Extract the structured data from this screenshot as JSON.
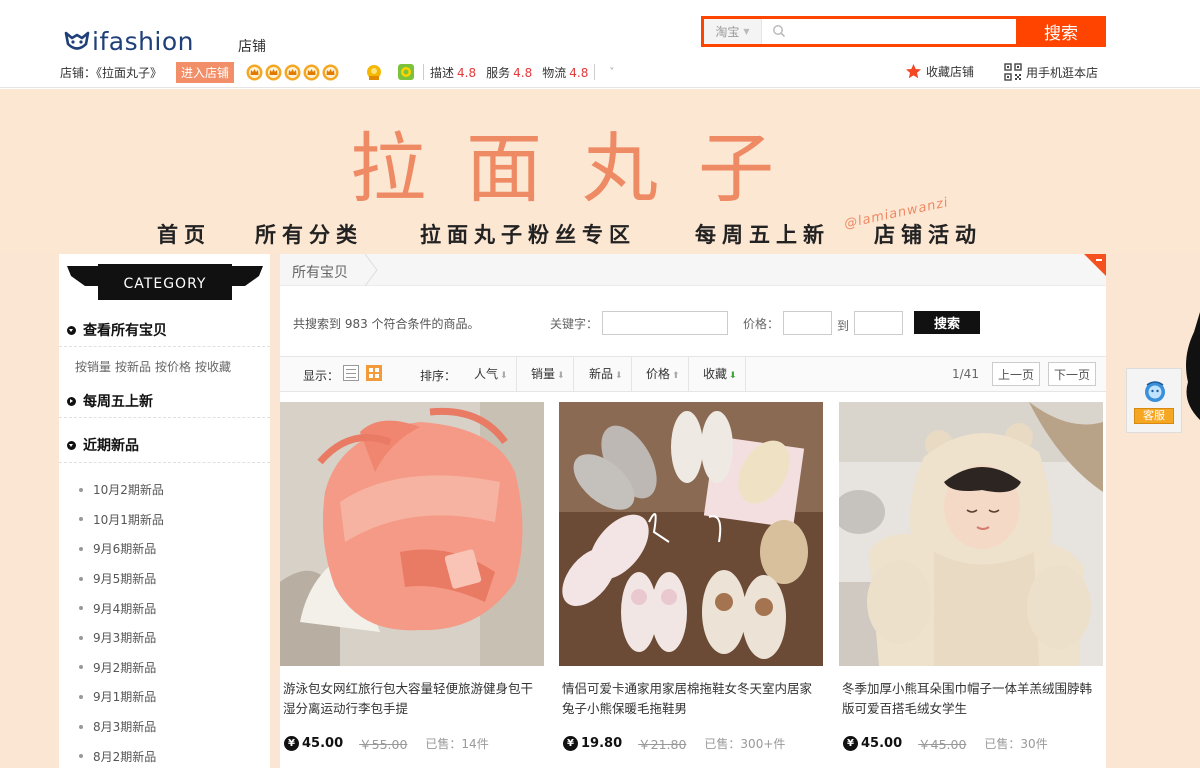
{
  "header": {
    "logo_text": "ifashion",
    "logo_sub": "店铺",
    "search": {
      "scope": "淘宝",
      "placeholder": "",
      "button_label": "搜索"
    },
    "shop": {
      "label": "店铺：《拉面丸子》",
      "enter_button": "进入店铺",
      "crown_count": 5,
      "ratings": [
        {
          "name": "描述",
          "score": "4.8"
        },
        {
          "name": "服务",
          "score": "4.8"
        },
        {
          "name": "物流",
          "score": "4.8"
        }
      ]
    },
    "favorite_shop": "收藏店铺",
    "mobile_shop": "用手机逛本店"
  },
  "banner": {
    "title": "拉面丸子",
    "handle": "@lamianwanzi",
    "nav": [
      "首页",
      "所有分类",
      "拉面丸子粉丝专区",
      "每周五上新",
      "店铺活动"
    ]
  },
  "sidebar": {
    "category_title": "CATEGORY",
    "all_items": "查看所有宝贝",
    "sort_links": [
      "按销量",
      "按新品",
      "按价格",
      "按收藏"
    ],
    "weekly_new": "每周五上新",
    "recent_new": "近期新品",
    "recent_items": [
      "10月2期新品",
      "10月1期新品",
      "9月6期新品",
      "9月5期新品",
      "9月4期新品",
      "9月3期新品",
      "9月2期新品",
      "9月1期新品",
      "8月3期新品",
      "8月2期新品"
    ]
  },
  "main": {
    "breadcrumb": "所有宝贝",
    "result_text": "共搜索到 983 个符合条件的商品。",
    "keyword_label": "关键字：",
    "price_label": "价格：",
    "price_to": "到",
    "filter_button": "搜索",
    "display_label": "显示：",
    "sort_label": "排序：",
    "sort_options": [
      "人气",
      "销量",
      "新品",
      "价格",
      "收藏"
    ],
    "page_info": "1/41",
    "prev_page": "上一页",
    "next_page": "下一页"
  },
  "products": [
    {
      "title": "游泳包女网红旅行包大容量轻便旅游健身包干湿分离运动行李包手提",
      "price": "45.00",
      "original_price": "￥55.00",
      "sold": "已售：14件"
    },
    {
      "title": "情侣可爱卡通家用家居棉拖鞋女冬天室内居家兔子小熊保暖毛拖鞋男",
      "price": "19.80",
      "original_price": "￥21.80",
      "sold": "已售：300+件"
    },
    {
      "title": "冬季加厚小熊耳朵围巾帽子一体羊羔绒围脖韩版可爱百搭毛绒女学生",
      "price": "45.00",
      "original_price": "￥45.00",
      "sold": "已售：30件"
    }
  ],
  "float": {
    "service_label": "客服"
  },
  "colors": {
    "accent": "#ff4400",
    "banner_bg": "#fce7d3",
    "banner_text": "#ee8a64",
    "rating": "#e4393c"
  }
}
